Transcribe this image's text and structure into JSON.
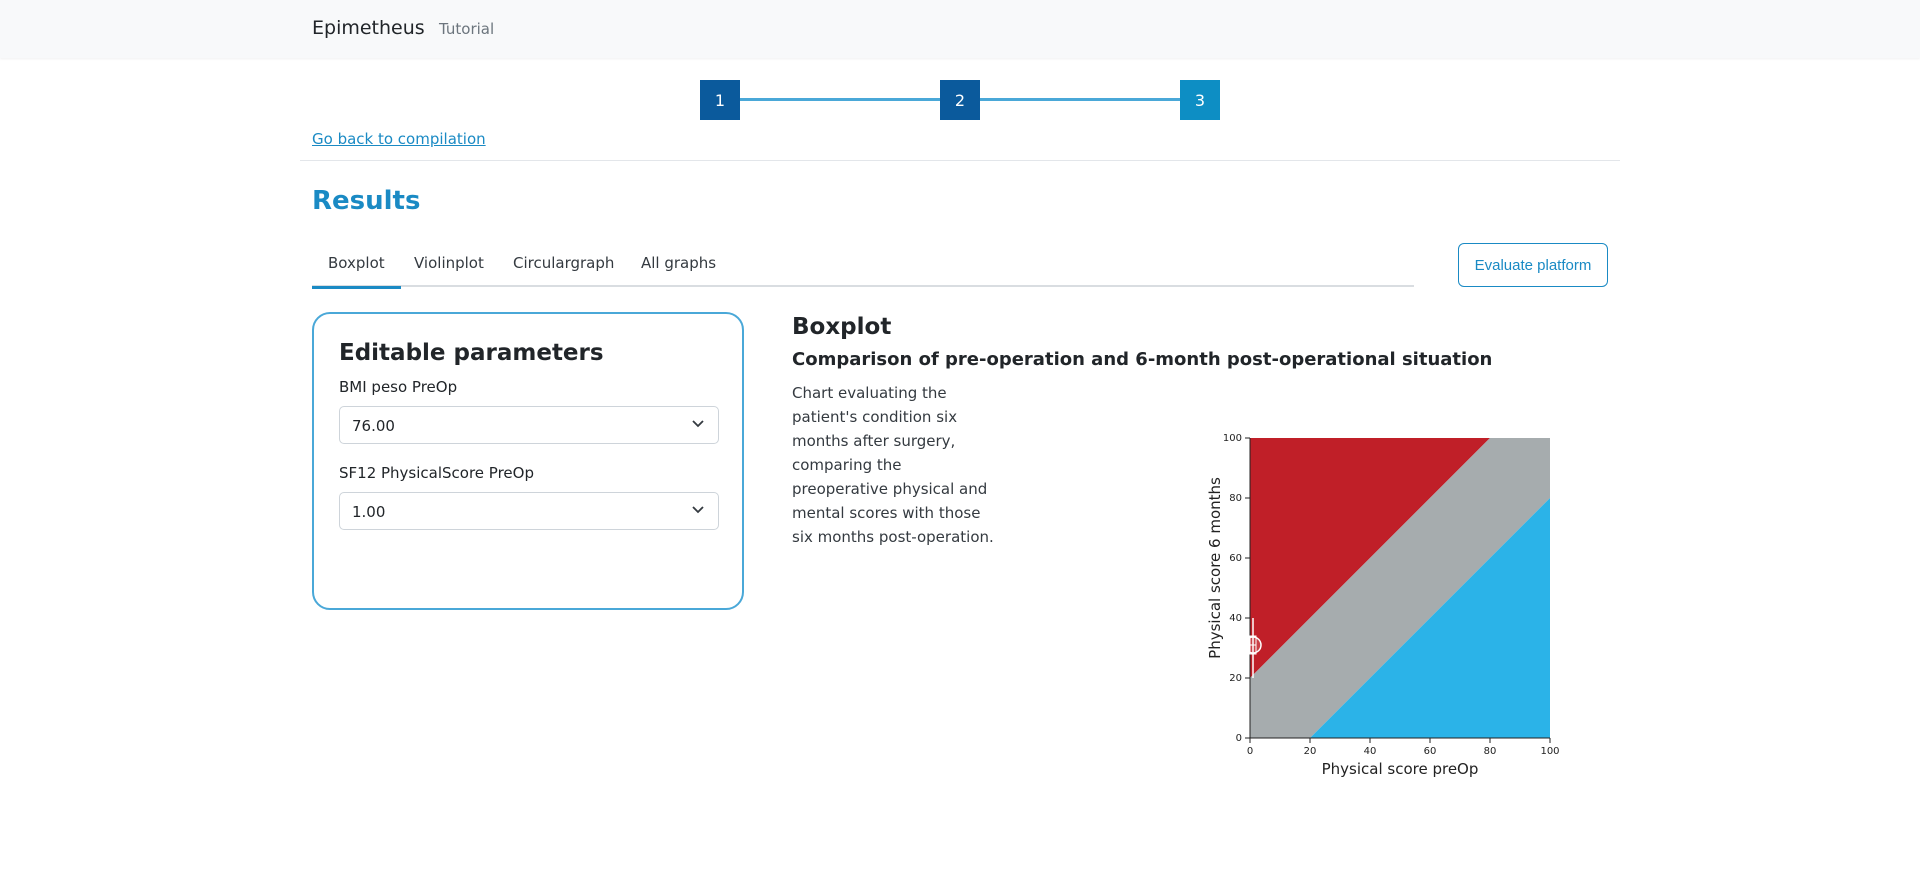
{
  "navbar": {
    "brand": "Epimetheus",
    "tutorial": "Tutorial"
  },
  "stepper": {
    "steps": [
      "1",
      "2",
      "3"
    ],
    "active_step": 3
  },
  "back_link": "Go back to compilation",
  "page_title": "Results",
  "tabs": [
    {
      "label": "Boxplot",
      "active": true
    },
    {
      "label": "Violinplot",
      "active": false
    },
    {
      "label": "Circulargraph",
      "active": false
    },
    {
      "label": "All graphs",
      "active": false
    }
  ],
  "evaluate_button": "Evaluate platform",
  "params": {
    "title": "Editable parameters",
    "fields": [
      {
        "label": "BMI peso PreOp",
        "value": "76.00"
      },
      {
        "label": "SF12 PhysicalScore PreOp",
        "value": "1.00"
      }
    ]
  },
  "chart_section": {
    "title": "Boxplot",
    "subtitle": "Comparison of pre-operation and 6-month post-operational situation",
    "description": "Chart evaluating the patient's condition six months after surgery, comparing the preoperative physical and mental scores with those six months post-operation."
  },
  "colors": {
    "accent": "#1a8ac4",
    "step_done": "#0b5a9c",
    "region_worse": "#c01f28",
    "region_same": "#a6acae",
    "region_better": "#2bb3e8"
  },
  "chart_data": {
    "type": "area",
    "xlabel": "Physical score preOp",
    "ylabel": "Physical score 6 months",
    "xlim": [
      0,
      100
    ],
    "ylim": [
      0,
      100
    ],
    "xticks": [
      "0",
      "20",
      "40",
      "60",
      "80",
      "100"
    ],
    "yticks": [
      "0",
      "20",
      "40",
      "60",
      "80",
      "100"
    ],
    "regions": [
      {
        "name": "worse",
        "color": "#c01f28",
        "polygon": [
          [
            0,
            20
          ],
          [
            0,
            100
          ],
          [
            80,
            100
          ]
        ]
      },
      {
        "name": "same",
        "color": "#a6acae",
        "polygon": [
          [
            0,
            0
          ],
          [
            20,
            0
          ],
          [
            100,
            80
          ],
          [
            100,
            100
          ],
          [
            80,
            100
          ],
          [
            0,
            20
          ]
        ]
      },
      {
        "name": "better",
        "color": "#2bb3e8",
        "polygon": [
          [
            20,
            0
          ],
          [
            100,
            0
          ],
          [
            100,
            80
          ]
        ]
      }
    ],
    "boxplot": {
      "x": 1,
      "min": 20,
      "q1": 28,
      "median": 31,
      "q3": 34,
      "max": 40
    },
    "patient_point": {
      "x": 1,
      "y": 31
    }
  }
}
